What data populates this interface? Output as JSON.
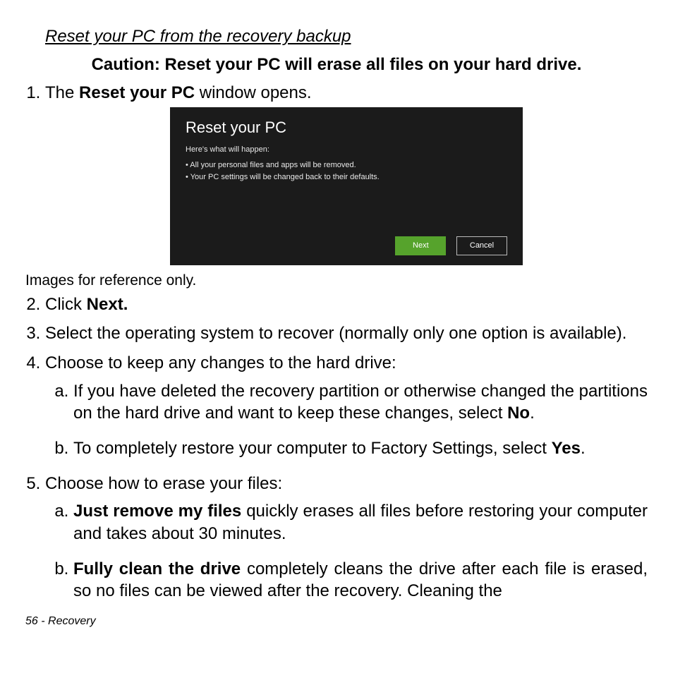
{
  "section_title": "Reset your PC from the recovery backup",
  "caution": "Caution: Reset your PC will erase all files on your hard drive.",
  "steps": {
    "s1_prefix": "The ",
    "s1_bold": "Reset your PC",
    "s1_suffix": " window opens.",
    "s2_prefix": "Click ",
    "s2_bold": "Next.",
    "s3": "Select the operating system to recover (normally only one option is available).",
    "s4": "Choose to keep any changes to the hard drive:",
    "s4a_text": "If you have deleted the recovery partition or otherwise changed the partitions on the hard drive and want to keep these changes, select ",
    "s4a_bold": "No",
    "s4a_suffix": ".",
    "s4b_text": "To completely restore your computer to Factory Settings, select ",
    "s4b_bold": "Yes",
    "s4b_suffix": ".",
    "s5": "Choose how to erase your files:",
    "s5a_bold": "Just remove my files",
    "s5a_text": " quickly erases all files before restoring your computer and takes about 30 minutes.",
    "s5b_bold": "Fully clean the drive",
    "s5b_text": " completely cleans the drive after each file is erased, so no files can be viewed after the recovery. Cleaning the"
  },
  "image_note": "Images for reference only.",
  "shot": {
    "title": "Reset your PC",
    "intro": "Here's what will happen:",
    "bullet1": "• All your personal files and apps will be removed.",
    "bullet2": "• Your PC settings will be changed back to their defaults.",
    "next": "Next",
    "cancel": "Cancel"
  },
  "footer": "56 - Recovery"
}
